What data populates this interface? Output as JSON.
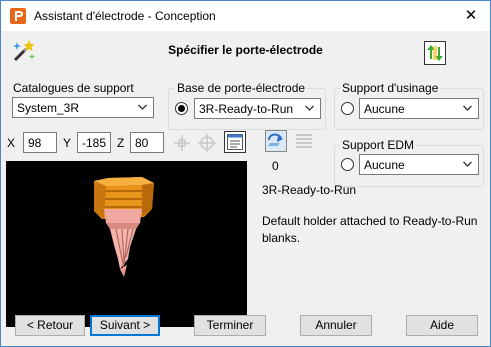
{
  "window": {
    "title": "Assistant d'électrode - Conception",
    "close_glyph": "✕"
  },
  "heading": "Spécifier le porte-électrode",
  "catalogues": {
    "label": "Catalogues de support",
    "selected": "System_3R"
  },
  "base": {
    "label": "Base de porte-électrode",
    "selected": "3R-Ready-to-Run",
    "radio_checked": true
  },
  "machining_support": {
    "label": "Support d'usinage",
    "selected": "Aucune",
    "radio_checked": false
  },
  "edm_support": {
    "label": "Support EDM",
    "selected": "Aucune",
    "radio_checked": false
  },
  "coords": {
    "x_label": "X",
    "x_value": "98",
    "y_label": "Y",
    "y_value": "-185",
    "z_label": "Z",
    "z_value": "80"
  },
  "rotation_count": "0",
  "info": {
    "name": "3R-Ready-to-Run",
    "description": "Default holder attached to Ready-to-Run blanks."
  },
  "buttons": {
    "back": "< Retour",
    "next": "Suivant >",
    "finish": "Terminer",
    "cancel": "Annuler",
    "help": "Aide"
  },
  "icons": [
    "app-logo-icon",
    "wizard-wand-icon",
    "swap-holder-icon",
    "snap-point-icon",
    "crosshair-icon",
    "list-dialog-icon",
    "rotate-icon",
    "menu-lines-icon"
  ],
  "colors": {
    "holder_body": "#e8931a",
    "holder_base": "#f0a8a0",
    "viewport_bg": "#000000",
    "focus_blue": "#0078d7"
  }
}
